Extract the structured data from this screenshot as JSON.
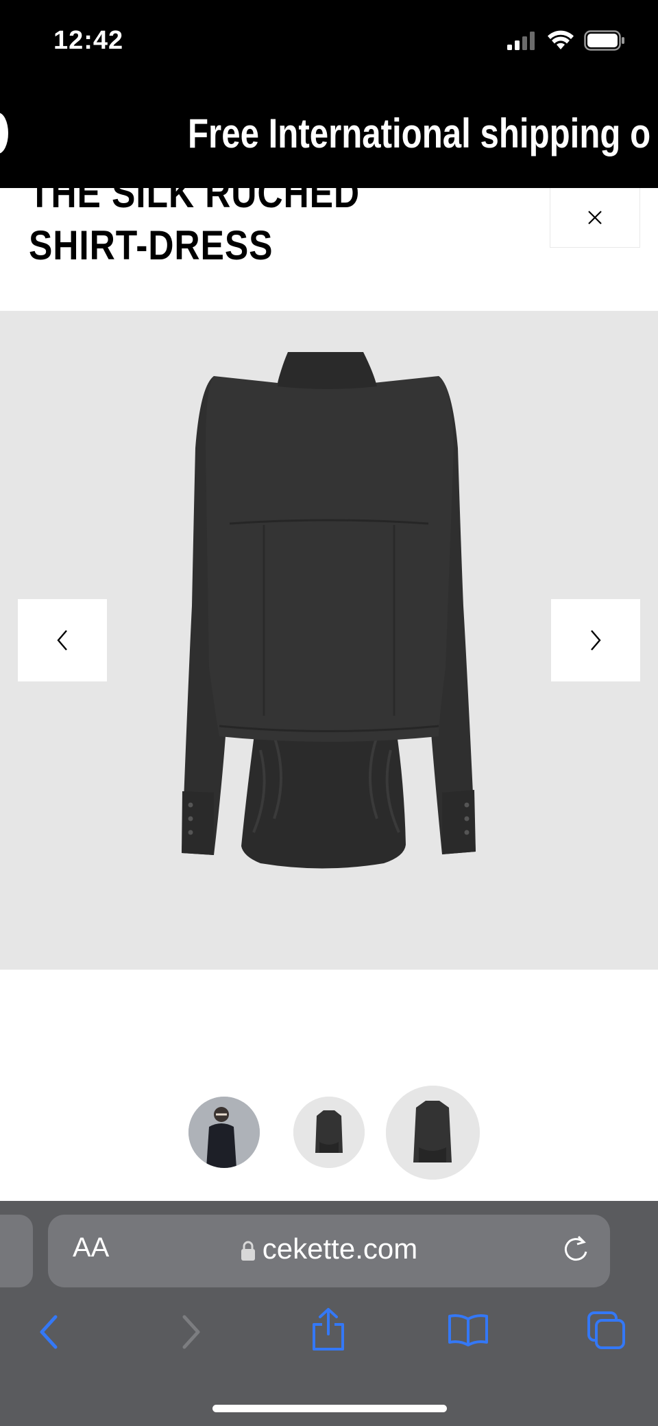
{
  "status_bar": {
    "time": "12:42"
  },
  "banner": {
    "text": "Free International shipping o"
  },
  "product": {
    "title_line1": "THE SILK RUCHED",
    "title_line2": "SHIRT-DRESS"
  },
  "gallery": {
    "image_alt": "Back view of black silk ruched shirt-dress",
    "thumbnail_count": 3,
    "selected_thumbnail": 3
  },
  "browser": {
    "text_size_label": "AA",
    "url": "cekette.com",
    "icons": [
      "lock-icon",
      "reload-icon",
      "back-icon",
      "forward-icon",
      "share-icon",
      "bookmarks-icon",
      "tabs-icon"
    ]
  },
  "colors": {
    "link_blue": "#3478f6",
    "toolbar_bg": "#5a5b5e",
    "gallery_bg": "#e6e6e6"
  }
}
